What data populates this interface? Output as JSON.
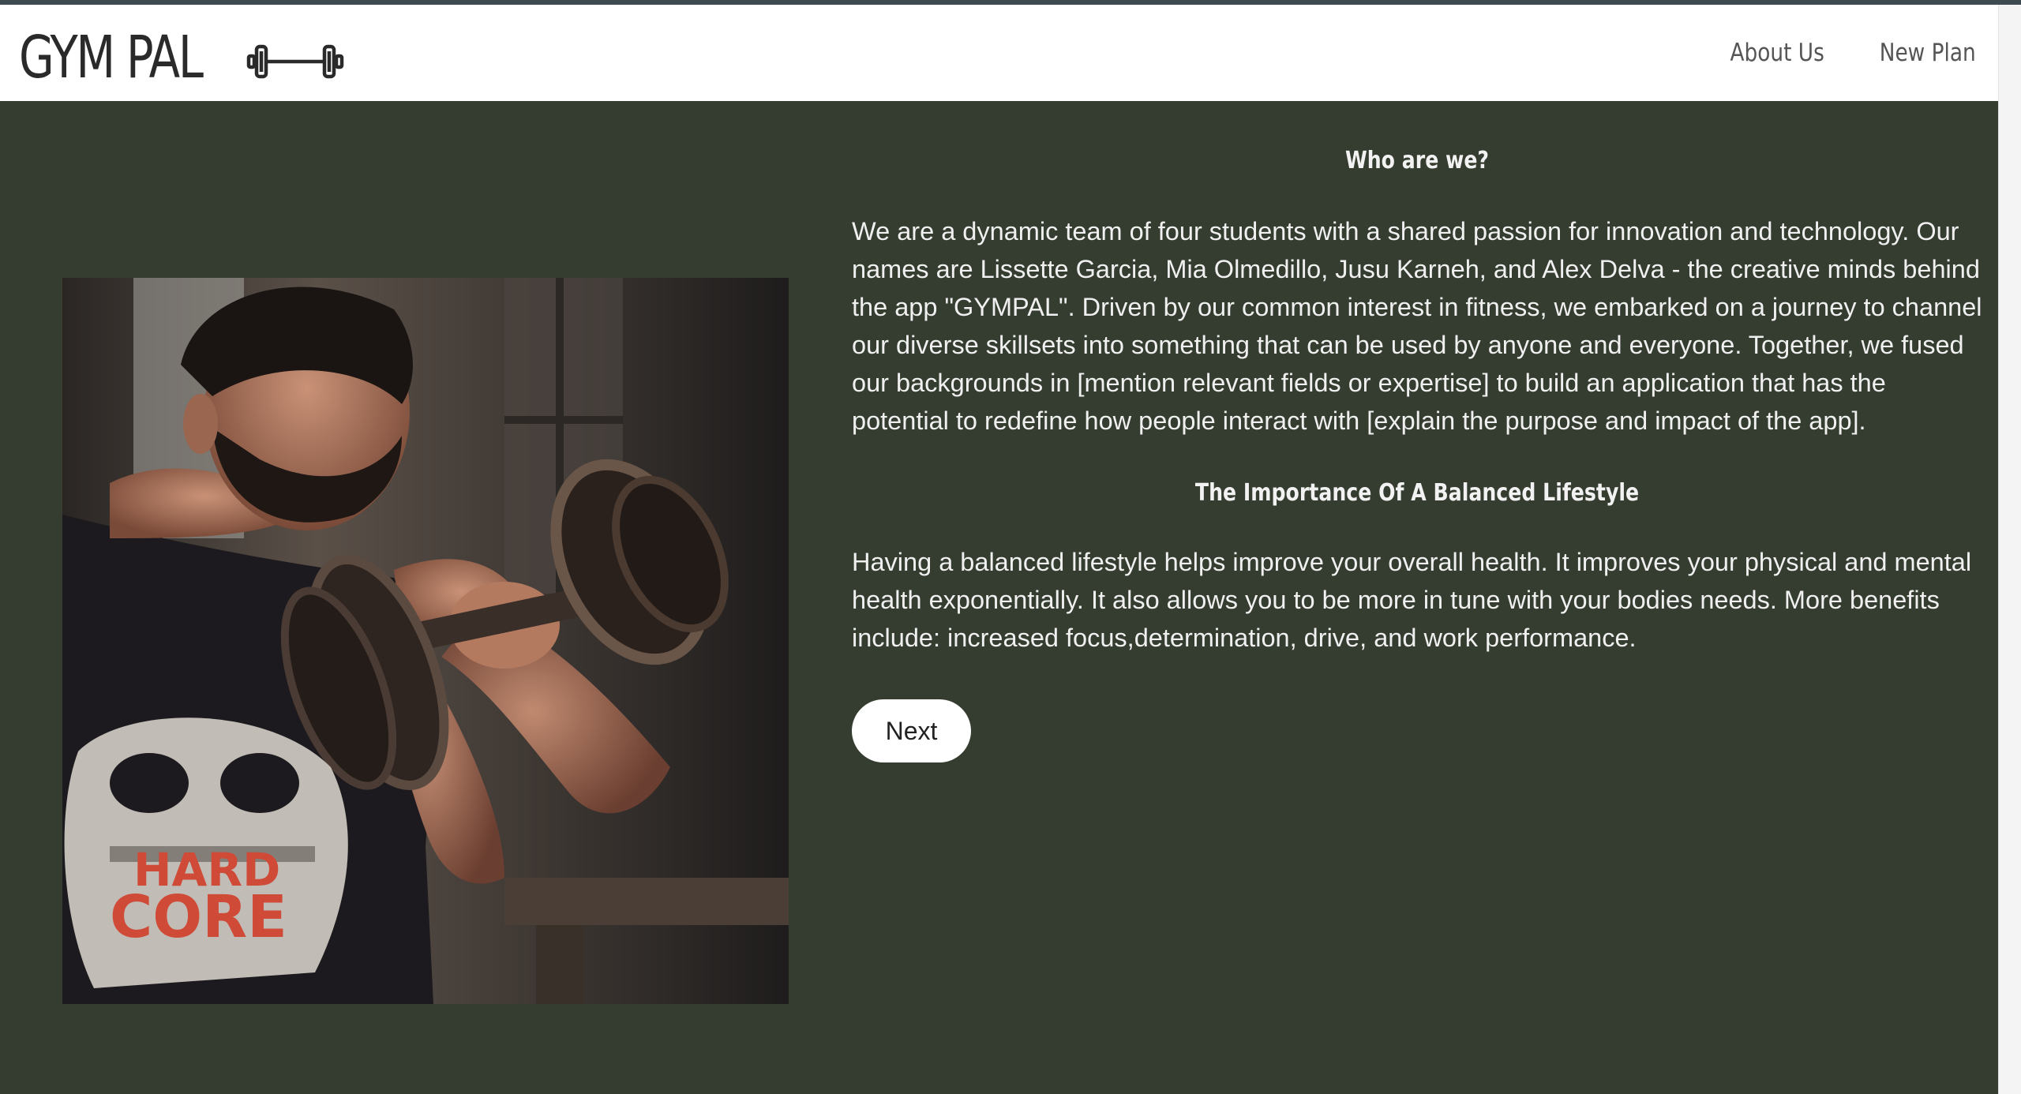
{
  "brand": {
    "name": "GYM PAL",
    "logo_icon": "dumbbell-icon"
  },
  "nav": {
    "items": [
      {
        "label": "About Us"
      },
      {
        "label": "New Plan"
      }
    ]
  },
  "about": {
    "heading_who": "Who are we?",
    "paragraph_who": "We are a dynamic team of four students with a shared passion for innovation and technology. Our names are Lissette Garcia, Mia Olmedillo, Jusu Karneh, and Alex Delva - the creative minds behind the app \"GYMPAL\". Driven by our common interest in fitness, we embarked on a journey to channel our diverse skillsets into something that can be used by anyone and everyone. Together, we fused our backgrounds in [mention relevant fields or expertise] to build an application that has the potential to redefine how people interact with [explain the purpose and impact of the app].",
    "heading_balance": "The Importance Of A Balanced Lifestyle",
    "paragraph_balance": "Having a balanced lifestyle helps improve your overall health. It improves your physical and mental health exponentially. It also allows you to be more in tune with your bodies needs. More benefits include: increased focus,determination, drive, and work performance.",
    "next_label": "Next"
  },
  "photo": {
    "shirt_text_line1": "HARD",
    "shirt_text_line2": "CORE"
  },
  "colors": {
    "content_bg": "#353d30",
    "navbar_bg": "#ffffff",
    "text_light": "#f0f0f0"
  }
}
